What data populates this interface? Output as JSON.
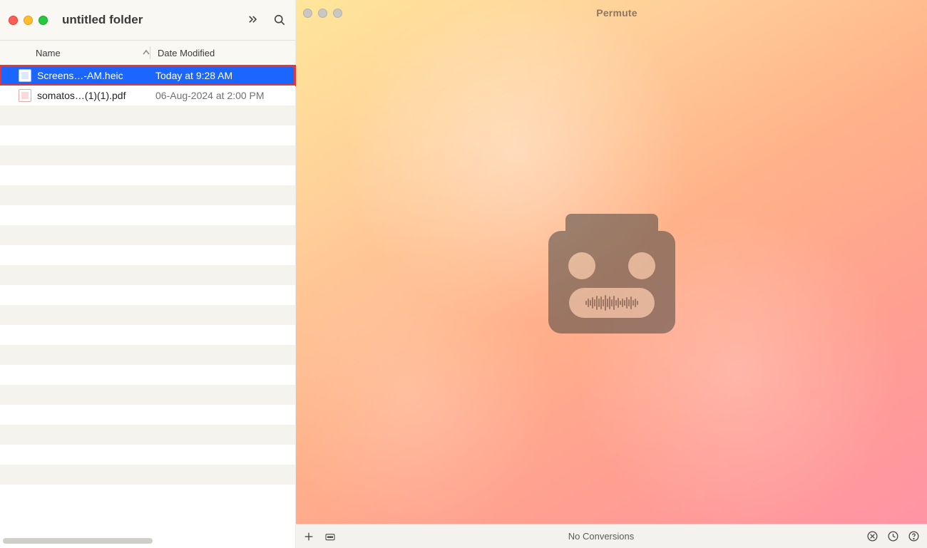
{
  "finder": {
    "title": "untitled folder",
    "columns": {
      "name": "Name",
      "date": "Date Modified"
    },
    "files": [
      {
        "name": "Screens…-AM.heic",
        "date": "Today at 9:28 AM",
        "type": "heic",
        "selected": true,
        "highlight": true
      },
      {
        "name": "somatos…(1)(1).pdf",
        "date": "06-Aug-2024 at 2:00 PM",
        "type": "pdf",
        "selected": false,
        "highlight": false
      }
    ]
  },
  "permute": {
    "title": "Permute",
    "footer_status": "No Conversions"
  }
}
